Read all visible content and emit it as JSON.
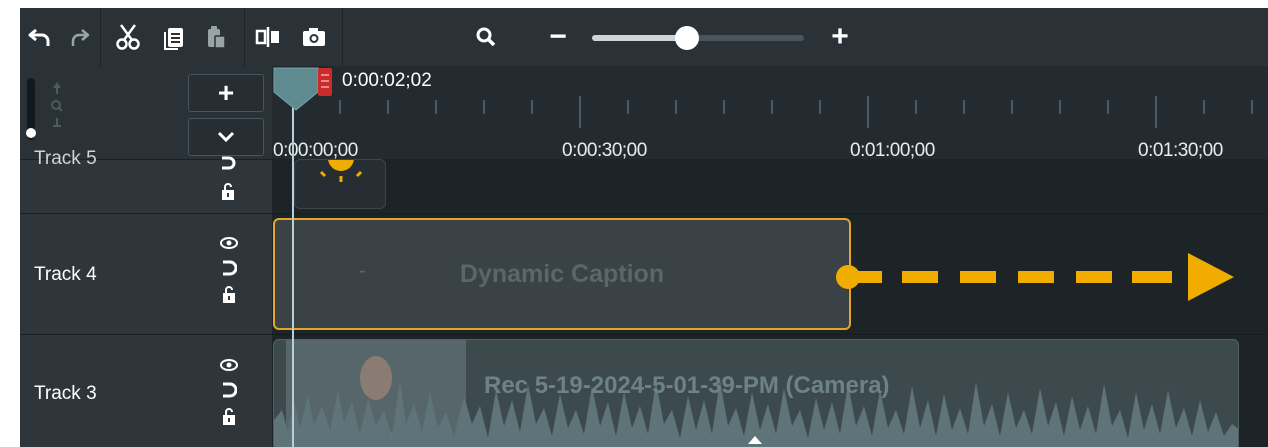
{
  "toolbar": {
    "icons": [
      "undo-icon",
      "redo-icon",
      "cut-icon",
      "copy-icon",
      "paste-icon",
      "split-icon",
      "snapshot-icon",
      "zoom-icon"
    ],
    "zoom_out_label": "−",
    "zoom_in_label": "+",
    "zoom_level": 0.45
  },
  "header": {
    "add_track_label": "+",
    "collapse_label": "⌄",
    "playhead_time": "0:00:02;02"
  },
  "ruler": {
    "labels": [
      "0:00:00;00",
      "0:00:30;00",
      "0:01:00;00",
      "0:01:30;00"
    ]
  },
  "tracks": [
    {
      "name": "Track 5",
      "clip_label": ""
    },
    {
      "name": "Track 4",
      "clip_label": "Dynamic Caption",
      "clip_marker": "-"
    },
    {
      "name": "Track 3",
      "clip_label": "Rec 5-19-2024-5-01-39-PM (Camera)"
    }
  ],
  "colors": {
    "accent": "#f0ad00",
    "selection_border": "#e4a529",
    "playhead": "#5f8a90",
    "playhead_end": "#cc2b2b"
  }
}
